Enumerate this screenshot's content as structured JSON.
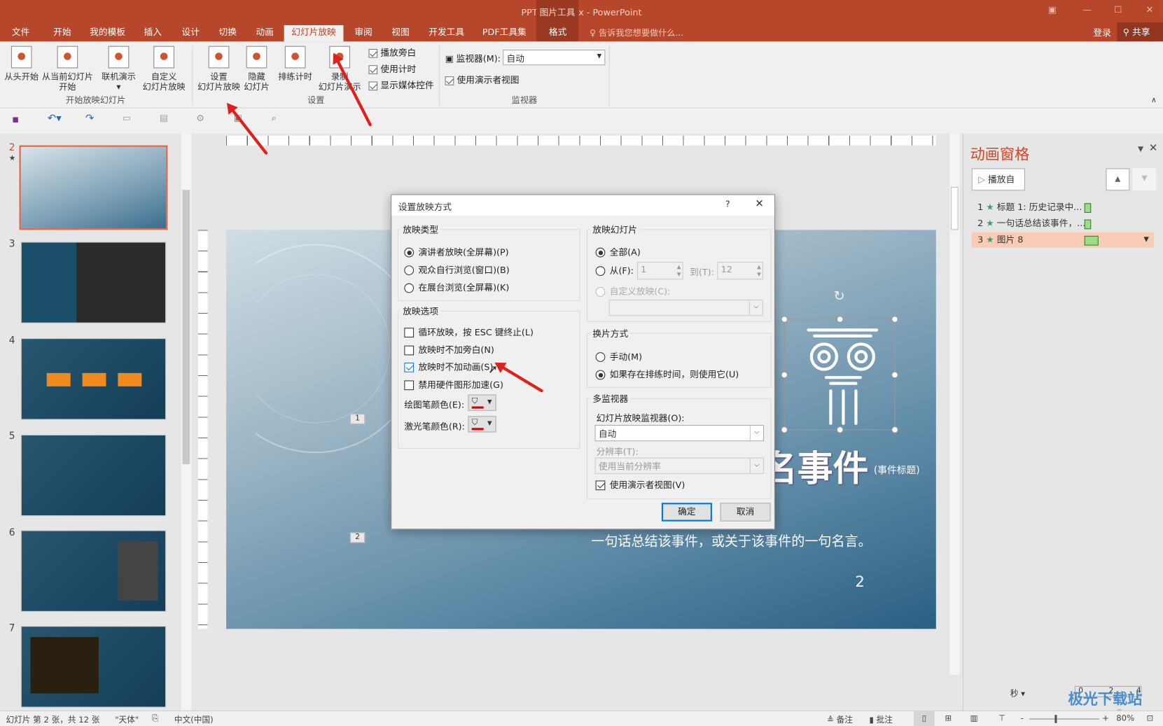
{
  "window": {
    "title": "PPT教程2.pptx - PowerPoint",
    "context_tab_group": "图片工具",
    "tell_me": "告诉我您想要做什么...",
    "login": "登录",
    "share": "共享"
  },
  "tabs": [
    "文件",
    "开始",
    "我的模板",
    "插入",
    "设计",
    "切换",
    "动画",
    "幻灯片放映",
    "审阅",
    "视图",
    "开发工具",
    "PDF工具集",
    "格式"
  ],
  "active_tab": "幻灯片放映",
  "ribbon": {
    "start_group": {
      "label": "开始放映幻灯片",
      "from_beginning": "从头开始",
      "from_current": "从当前幻灯片\n开始",
      "online": "联机演示",
      "custom": "自定义\n幻灯片放映"
    },
    "setup_group": {
      "label": "设置",
      "setup_show": "设置\n幻灯片放映",
      "hide_slide": "隐藏\n幻灯片",
      "rehearse": "排练计时",
      "record": "录制\n幻灯片演示",
      "play_narrations": "播放旁白",
      "use_timings": "使用计时",
      "show_media_controls": "显示媒体控件"
    },
    "monitors_group": {
      "label": "监视器",
      "monitor_label": "监视器(M):",
      "monitor_value": "自动",
      "presenter_view": "使用演示者视图"
    }
  },
  "slides": [
    {
      "num": "2",
      "star": "★",
      "selected": true
    },
    {
      "num": "3"
    },
    {
      "num": "4"
    },
    {
      "num": "5"
    },
    {
      "num": "6"
    },
    {
      "num": "7"
    }
  ],
  "slide": {
    "title_visible": "名事件",
    "title_note": "(事件标题)",
    "subtitle": "一句话总结该事件，或关于该事件的一句名言。",
    "page_number": "2",
    "anim_tags": [
      "1",
      "2"
    ]
  },
  "anim_pane": {
    "title": "动画窗格",
    "play_from": "播放自",
    "items": [
      {
        "num": "1",
        "label": "标题 1: 历史记录中..."
      },
      {
        "num": "2",
        "label": "一句话总结该事件，..."
      },
      {
        "num": "3",
        "label": "图片 8",
        "selected": true
      }
    ],
    "seconds": "秒",
    "timeline": [
      "0",
      "2",
      "4"
    ]
  },
  "dialog": {
    "title": "设置放映方式",
    "help": "?",
    "show_type": {
      "label": "放映类型",
      "options": [
        {
          "label": "演讲者放映(全屏幕)(P)",
          "checked": true
        },
        {
          "label": "观众自行浏览(窗口)(B)",
          "checked": false
        },
        {
          "label": "在展台浏览(全屏幕)(K)",
          "checked": false
        }
      ]
    },
    "show_options": {
      "label": "放映选项",
      "options": [
        {
          "label": "循环放映，按 ESC 键终止(L)",
          "checked": false
        },
        {
          "label": "放映时不加旁白(N)",
          "checked": false
        },
        {
          "label": "放映时不加动画(S)",
          "checked": true
        },
        {
          "label": "禁用硬件图形加速(G)",
          "checked": false
        }
      ],
      "pen_color": "绘图笔颜色(E):",
      "laser_color": "激光笔颜色(R):",
      "pen_color_value": "#e00000"
    },
    "show_slides": {
      "label": "放映幻灯片",
      "all": "全部(A)",
      "from": "从(F):",
      "from_value": "1",
      "to": "到(T):",
      "to_value": "12",
      "custom": "自定义放映(C):"
    },
    "advance": {
      "label": "换片方式",
      "manual": "手动(M)",
      "timings": "如果存在排练时间，则使用它(U)"
    },
    "multi_monitor": {
      "label": "多监视器",
      "monitor_label": "幻灯片放映监视器(O):",
      "monitor_value": "自动",
      "resolution_label": "分辨率(T):",
      "resolution_value": "使用当前分辨率",
      "presenter_view": "使用演示者视图(V)"
    },
    "ok": "确定",
    "cancel": "取消"
  },
  "status": {
    "slide_info": "幻灯片 第 2 张，共 12 张",
    "theme": "\"天体\"",
    "language": "中文(中国)",
    "notes": "备注",
    "comments": "批注",
    "zoom": "80%"
  },
  "watermark": {
    "text": "极光下载站",
    "url": "www.xz7.com"
  },
  "colors": {
    "accent": "#b7472a",
    "annotation_arrow": "#e0201a"
  }
}
